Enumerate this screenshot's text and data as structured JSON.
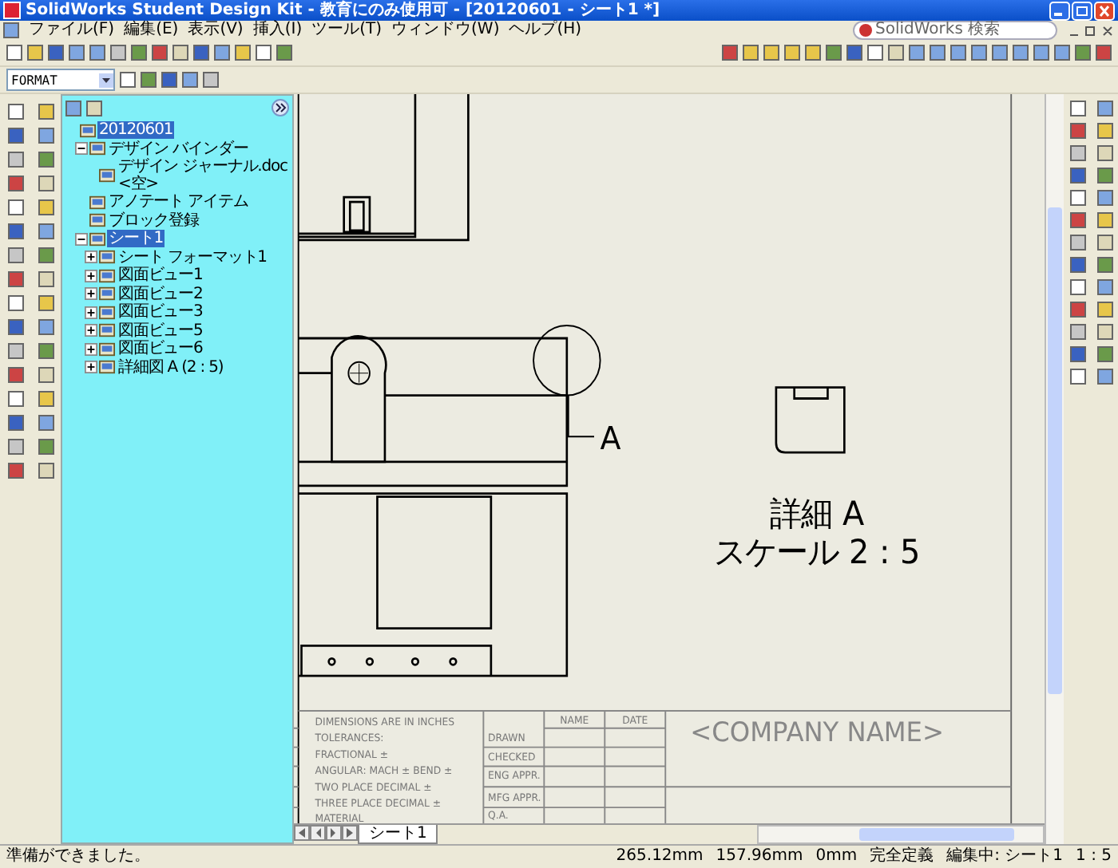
{
  "window": {
    "title": "SolidWorks Student Design Kit - 教育にのみ使用可 - [20120601 - シート1 *]"
  },
  "menu": [
    "ファイル(F)",
    "編集(E)",
    "表示(V)",
    "挿入(I)",
    "ツール(T)",
    "ウィンドウ(W)",
    "ヘルプ(H)"
  ],
  "search": {
    "placeholder": "SolidWorks 検索"
  },
  "format_combo": {
    "value": "FORMAT"
  },
  "feature_tree": {
    "items": [
      {
        "label": "20120601",
        "selected": true,
        "children": [
          {
            "label": "デザイン バインダー",
            "selected": false,
            "expanded": true,
            "children": [
              {
                "label": "デザイン ジャーナル.doc <空>",
                "selected": false
              }
            ]
          },
          {
            "label": "アノテート アイテム",
            "selected": false
          },
          {
            "label": "ブロック登録",
            "selected": false
          },
          {
            "label": "シート1",
            "selected": true,
            "expanded": true,
            "children": [
              {
                "label": "シート フォーマット1",
                "selected": false,
                "expanded": false
              },
              {
                "label": "図面ビュー1",
                "selected": false,
                "expanded": false
              },
              {
                "label": "図面ビュー2",
                "selected": false,
                "expanded": false
              },
              {
                "label": "図面ビュー3",
                "selected": false,
                "expanded": false
              },
              {
                "label": "図面ビュー5",
                "selected": false,
                "expanded": false
              },
              {
                "label": "図面ビュー6",
                "selected": false,
                "expanded": false
              },
              {
                "label": "詳細図 A (2 : 5)",
                "selected": false,
                "expanded": false
              }
            ]
          }
        ]
      }
    ]
  },
  "drawing": {
    "detail_label": "A",
    "detail_title": "詳細 A",
    "detail_scale": "スケール 2 : 5",
    "title_block": {
      "notes": [
        "DIMENSIONS ARE IN INCHES",
        "TOLERANCES:",
        "FRACTIONAL ±",
        "ANGULAR: MACH ±   BEND ±",
        "TWO PLACE DECIMAL   ±",
        "THREE PLACE DECIMAL  ±"
      ],
      "material": "MATERIAL",
      "headers": [
        "NAME",
        "DATE"
      ],
      "row_labels": [
        "DRAWN",
        "CHECKED",
        "ENG APPR.",
        "MFG APPR.",
        "Q.A."
      ],
      "company": "<COMPANY NAME>"
    }
  },
  "sheet_tabs": [
    {
      "label": "シート1",
      "selected": true
    }
  ],
  "status_bar": {
    "message": "準備ができました。",
    "x": "265.12mm",
    "y": "157.96mm",
    "z": "0mm",
    "state": "完全定義",
    "editing": "編集中: シート1",
    "scale": "1 : 5"
  }
}
